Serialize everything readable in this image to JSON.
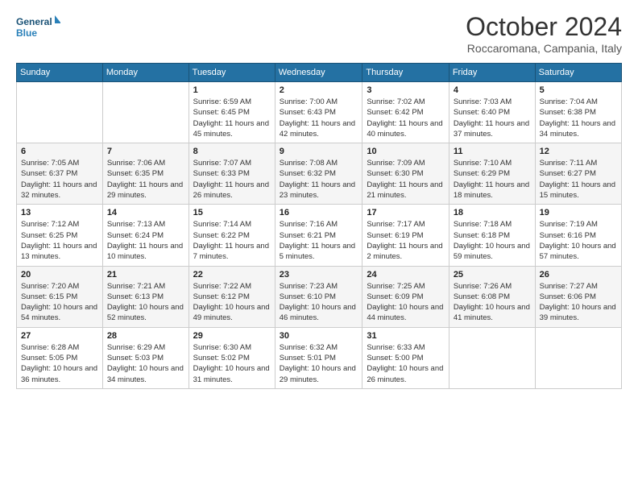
{
  "header": {
    "logo_line1": "General",
    "logo_line2": "Blue",
    "month": "October 2024",
    "location": "Roccaromana, Campania, Italy"
  },
  "days_of_week": [
    "Sunday",
    "Monday",
    "Tuesday",
    "Wednesday",
    "Thursday",
    "Friday",
    "Saturday"
  ],
  "weeks": [
    [
      {
        "day": "",
        "info": ""
      },
      {
        "day": "",
        "info": ""
      },
      {
        "day": "1",
        "info": "Sunrise: 6:59 AM\nSunset: 6:45 PM\nDaylight: 11 hours and 45 minutes."
      },
      {
        "day": "2",
        "info": "Sunrise: 7:00 AM\nSunset: 6:43 PM\nDaylight: 11 hours and 42 minutes."
      },
      {
        "day": "3",
        "info": "Sunrise: 7:02 AM\nSunset: 6:42 PM\nDaylight: 11 hours and 40 minutes."
      },
      {
        "day": "4",
        "info": "Sunrise: 7:03 AM\nSunset: 6:40 PM\nDaylight: 11 hours and 37 minutes."
      },
      {
        "day": "5",
        "info": "Sunrise: 7:04 AM\nSunset: 6:38 PM\nDaylight: 11 hours and 34 minutes."
      }
    ],
    [
      {
        "day": "6",
        "info": "Sunrise: 7:05 AM\nSunset: 6:37 PM\nDaylight: 11 hours and 32 minutes."
      },
      {
        "day": "7",
        "info": "Sunrise: 7:06 AM\nSunset: 6:35 PM\nDaylight: 11 hours and 29 minutes."
      },
      {
        "day": "8",
        "info": "Sunrise: 7:07 AM\nSunset: 6:33 PM\nDaylight: 11 hours and 26 minutes."
      },
      {
        "day": "9",
        "info": "Sunrise: 7:08 AM\nSunset: 6:32 PM\nDaylight: 11 hours and 23 minutes."
      },
      {
        "day": "10",
        "info": "Sunrise: 7:09 AM\nSunset: 6:30 PM\nDaylight: 11 hours and 21 minutes."
      },
      {
        "day": "11",
        "info": "Sunrise: 7:10 AM\nSunset: 6:29 PM\nDaylight: 11 hours and 18 minutes."
      },
      {
        "day": "12",
        "info": "Sunrise: 7:11 AM\nSunset: 6:27 PM\nDaylight: 11 hours and 15 minutes."
      }
    ],
    [
      {
        "day": "13",
        "info": "Sunrise: 7:12 AM\nSunset: 6:25 PM\nDaylight: 11 hours and 13 minutes."
      },
      {
        "day": "14",
        "info": "Sunrise: 7:13 AM\nSunset: 6:24 PM\nDaylight: 11 hours and 10 minutes."
      },
      {
        "day": "15",
        "info": "Sunrise: 7:14 AM\nSunset: 6:22 PM\nDaylight: 11 hours and 7 minutes."
      },
      {
        "day": "16",
        "info": "Sunrise: 7:16 AM\nSunset: 6:21 PM\nDaylight: 11 hours and 5 minutes."
      },
      {
        "day": "17",
        "info": "Sunrise: 7:17 AM\nSunset: 6:19 PM\nDaylight: 11 hours and 2 minutes."
      },
      {
        "day": "18",
        "info": "Sunrise: 7:18 AM\nSunset: 6:18 PM\nDaylight: 10 hours and 59 minutes."
      },
      {
        "day": "19",
        "info": "Sunrise: 7:19 AM\nSunset: 6:16 PM\nDaylight: 10 hours and 57 minutes."
      }
    ],
    [
      {
        "day": "20",
        "info": "Sunrise: 7:20 AM\nSunset: 6:15 PM\nDaylight: 10 hours and 54 minutes."
      },
      {
        "day": "21",
        "info": "Sunrise: 7:21 AM\nSunset: 6:13 PM\nDaylight: 10 hours and 52 minutes."
      },
      {
        "day": "22",
        "info": "Sunrise: 7:22 AM\nSunset: 6:12 PM\nDaylight: 10 hours and 49 minutes."
      },
      {
        "day": "23",
        "info": "Sunrise: 7:23 AM\nSunset: 6:10 PM\nDaylight: 10 hours and 46 minutes."
      },
      {
        "day": "24",
        "info": "Sunrise: 7:25 AM\nSunset: 6:09 PM\nDaylight: 10 hours and 44 minutes."
      },
      {
        "day": "25",
        "info": "Sunrise: 7:26 AM\nSunset: 6:08 PM\nDaylight: 10 hours and 41 minutes."
      },
      {
        "day": "26",
        "info": "Sunrise: 7:27 AM\nSunset: 6:06 PM\nDaylight: 10 hours and 39 minutes."
      }
    ],
    [
      {
        "day": "27",
        "info": "Sunrise: 6:28 AM\nSunset: 5:05 PM\nDaylight: 10 hours and 36 minutes."
      },
      {
        "day": "28",
        "info": "Sunrise: 6:29 AM\nSunset: 5:03 PM\nDaylight: 10 hours and 34 minutes."
      },
      {
        "day": "29",
        "info": "Sunrise: 6:30 AM\nSunset: 5:02 PM\nDaylight: 10 hours and 31 minutes."
      },
      {
        "day": "30",
        "info": "Sunrise: 6:32 AM\nSunset: 5:01 PM\nDaylight: 10 hours and 29 minutes."
      },
      {
        "day": "31",
        "info": "Sunrise: 6:33 AM\nSunset: 5:00 PM\nDaylight: 10 hours and 26 minutes."
      },
      {
        "day": "",
        "info": ""
      },
      {
        "day": "",
        "info": ""
      }
    ]
  ]
}
